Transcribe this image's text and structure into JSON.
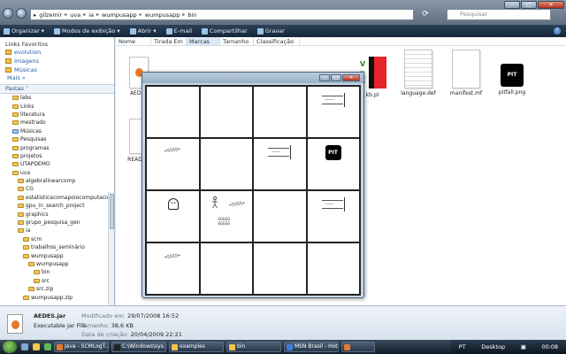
{
  "address": {
    "crumbs": [
      "gilzemir",
      "uva",
      "ia",
      "wumpusapp",
      "wumpusapp",
      "bin"
    ],
    "search_placeholder": "Pesquisar"
  },
  "toolbar": {
    "organize": "Organizar",
    "view_modes": "Modos de exibição",
    "open": "Abrir",
    "email": "E-mail",
    "share": "Compartilhar",
    "burn": "Gravar"
  },
  "nav": {
    "favorites_title": "Links Favoritos",
    "favorites": [
      "evolution",
      "Imagens",
      "Músicas"
    ],
    "more": "Mais",
    "folders_title": "Pastas",
    "tree": [
      {
        "label": "labs",
        "indent": 1
      },
      {
        "label": "Links",
        "indent": 1
      },
      {
        "label": "literatura",
        "indent": 1
      },
      {
        "label": "mestrado",
        "indent": 1
      },
      {
        "label": "Músicas",
        "indent": 1
      },
      {
        "label": "Pesquisas",
        "indent": 1
      },
      {
        "label": "programas",
        "indent": 1
      },
      {
        "label": "projetos",
        "indent": 1
      },
      {
        "label": "UTAPDEMO",
        "indent": 1
      },
      {
        "label": "uva",
        "indent": 1
      },
      {
        "label": "algebralinearcomp",
        "indent": 2
      },
      {
        "label": "CG",
        "indent": 2
      },
      {
        "label": "estatisticacomapoiocomputacio",
        "indent": 2
      },
      {
        "label": "gpu_in_search_project",
        "indent": 2
      },
      {
        "label": "graphics",
        "indent": 2
      },
      {
        "label": "grupo_pesquisa_gen",
        "indent": 2
      },
      {
        "label": "ia",
        "indent": 2
      },
      {
        "label": "scm",
        "indent": 3
      },
      {
        "label": "trabalhos_seminário",
        "indent": 3
      },
      {
        "label": "wumpusapp",
        "indent": 3
      },
      {
        "label": "wumpusapp",
        "indent": 4
      },
      {
        "label": "bin",
        "indent": 5
      },
      {
        "label": "src",
        "indent": 5
      },
      {
        "label": "src.zip",
        "indent": 4
      },
      {
        "label": "wumpusapp.zip",
        "indent": 3
      }
    ]
  },
  "columns": [
    "Nome",
    "Tirada Em",
    "Marcas",
    "Tamanho",
    "Classificação"
  ],
  "files": {
    "aedes": "AEDES",
    "readme": "README",
    "kb": "kb.pl",
    "language": "language.def",
    "manifest": "manifest.mf",
    "pitfall": "pitfall.png"
  },
  "pit_label": "PIT",
  "details": {
    "name": "AEDES.jar",
    "type": "Executable Jar File",
    "modified_label": "Modificado em:",
    "modified": "29/07/2008 16:52",
    "size_label": "Tamanho:",
    "size": "38,6 KB",
    "created_label": "Data de criação:",
    "created": "20/04/2009 22:21"
  },
  "game": {
    "stench_text": "≈SSSS≈",
    "breeze_text": "~~~",
    "gold_text": "GGGGG\nGGGGG"
  },
  "taskbar": {
    "tasks": [
      "Java - SCMLogT...",
      "C:\\Windows\\sys...",
      "examples",
      "bin",
      "MSN Brasil - Hot...",
      ""
    ],
    "lang": "PT",
    "desktop": "Desktop",
    "clock": "00:08"
  }
}
